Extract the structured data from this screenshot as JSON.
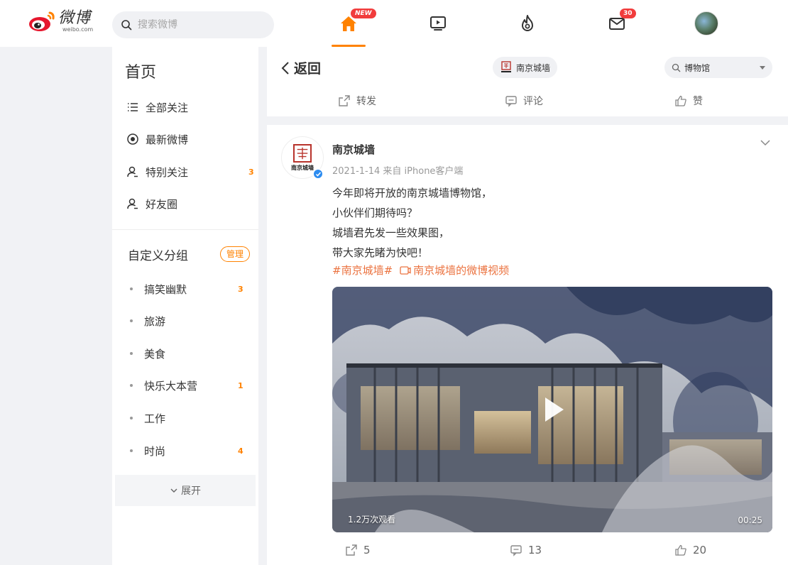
{
  "brand": {
    "name_cn": "微博",
    "name_en": "weibo.com",
    "accent": "#ff8200"
  },
  "top_search": {
    "placeholder": "搜索微博"
  },
  "top_nav": {
    "home_badge": "NEW",
    "message_badge": "30"
  },
  "sidebar": {
    "title": "首页",
    "items": [
      {
        "label": "全部关注",
        "icon": "list-icon"
      },
      {
        "label": "最新微博",
        "icon": "radio-icon"
      },
      {
        "label": "特别关注",
        "icon": "user-star-icon",
        "count": "3"
      },
      {
        "label": "好友圈",
        "icon": "user-icon"
      }
    ],
    "group_title": "自定义分组",
    "manage_label": "管理",
    "groups": [
      {
        "label": "搞笑幽默",
        "count": "3"
      },
      {
        "label": "旅游"
      },
      {
        "label": "美食"
      },
      {
        "label": "快乐大本营",
        "count": "1"
      },
      {
        "label": "工作"
      },
      {
        "label": "时尚",
        "count": "4"
      }
    ],
    "expand_label": "展开"
  },
  "header": {
    "back_label": "返回",
    "account_pill": "南京城墙",
    "search_value": "博物馆",
    "actions": {
      "repost": "转发",
      "comment": "评论",
      "like": "赞"
    }
  },
  "post": {
    "author": "南京城墙",
    "avatar_text": "南京城墙",
    "meta": "2021-1-14 来自 iPhone客户端",
    "lines": [
      "今年即将开放的南京城墙博物馆，",
      "小伙伴们期待吗？",
      "城墙君先发一些效果图，",
      "带大家先睹为快吧！"
    ],
    "hashtag": "#南京城墙#",
    "video_link": "南京城墙的微博视频",
    "video": {
      "views": "1.2万次观看",
      "duration": "00:25"
    },
    "stats": {
      "reposts": "5",
      "comments": "13",
      "likes": "20"
    }
  }
}
